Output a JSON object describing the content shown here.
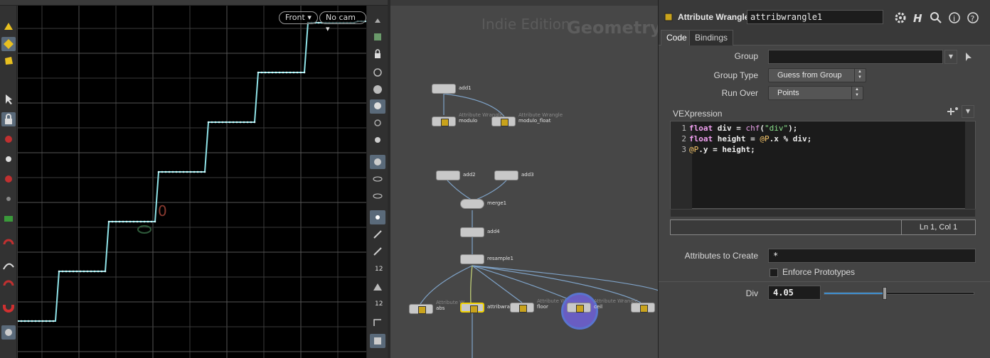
{
  "viewport": {
    "view_label": "Front",
    "camera_label": "No cam",
    "markers": {
      "zero_text": "0",
      "o_text": "0"
    }
  },
  "network": {
    "watermark_edition": "Indie Edition",
    "watermark_context": "Geometry",
    "nodes": [
      {
        "id": "add1",
        "name": "add1",
        "sub": "",
        "type": "add"
      },
      {
        "id": "modulo",
        "name": "modulo",
        "sub": "Attribute Wrangle",
        "type": "wrangle"
      },
      {
        "id": "modulo_float",
        "name": "modulo_float",
        "sub": "Attribute Wrangle",
        "type": "wrangle"
      },
      {
        "id": "add2",
        "name": "add2",
        "sub": "",
        "type": "add"
      },
      {
        "id": "add3",
        "name": "add3",
        "sub": "",
        "type": "add"
      },
      {
        "id": "merge1",
        "name": "merge1",
        "sub": "",
        "type": "merge"
      },
      {
        "id": "add4",
        "name": "add4",
        "sub": "",
        "type": "add"
      },
      {
        "id": "resample1",
        "name": "resample1",
        "sub": "",
        "type": "add"
      },
      {
        "id": "abs",
        "name": "abs",
        "sub": "Attribute W",
        "type": "wrangle"
      },
      {
        "id": "attribwrangle1",
        "name": "attribwran",
        "sub": "",
        "type": "wrangle"
      },
      {
        "id": "floor",
        "name": "floor",
        "sub": "Attribute Wrangle",
        "type": "wrangle"
      },
      {
        "id": "ceil",
        "name": "ceil",
        "sub": "Attribute Wrangle",
        "type": "wrangle"
      },
      {
        "id": "unnamed",
        "name": "",
        "sub": "",
        "type": "wrangle"
      }
    ]
  },
  "params": {
    "node_type": "Attribute Wrangle",
    "node_name": "attribwrangle1",
    "tabs": [
      "Code",
      "Bindings"
    ],
    "active_tab": "Code",
    "group_label": "Group",
    "group_value": "",
    "group_type_label": "Group Type",
    "group_type_value": "Guess from Group",
    "run_over_label": "Run Over",
    "run_over_value": "Points",
    "vex_label": "VEXpression",
    "code_lines": [
      {
        "n": "1",
        "parts": [
          [
            "kw",
            "float"
          ],
          [
            "tx",
            " div = "
          ],
          [
            "fn",
            "chf"
          ],
          [
            "tx",
            "("
          ],
          [
            "str",
            "\"div\""
          ],
          [
            "tx",
            ");"
          ]
        ]
      },
      {
        "n": "2",
        "parts": [
          [
            "kw",
            "float"
          ],
          [
            "tx",
            " height = "
          ],
          [
            "attr",
            "@P"
          ],
          [
            "tx",
            ".x % div;"
          ]
        ]
      },
      {
        "n": "3",
        "parts": [
          [
            "attr",
            "@P"
          ],
          [
            "tx",
            ".y = height;"
          ]
        ]
      }
    ],
    "cursor_pos": "Ln 1, Col 1",
    "attrs_to_create_label": "Attributes to Create",
    "attrs_to_create_value": "*",
    "enforce_prototypes_label": "Enforce Prototypes",
    "enforce_prototypes_checked": false,
    "div_label": "Div",
    "div_value": "4.05",
    "div_slider_fraction": 0.405
  },
  "icons": [
    "gear-icon",
    "help-h-icon",
    "search-icon",
    "info-icon",
    "question-icon",
    "pin-arrow-icon",
    "add-spare-icon"
  ],
  "colors": {
    "curve": "#8fe3e8",
    "grid": "#3a3a3a",
    "selected_node": "#f0d000",
    "current_halo": "#6b5fc9",
    "slider_fill": "#3f8fd0"
  }
}
